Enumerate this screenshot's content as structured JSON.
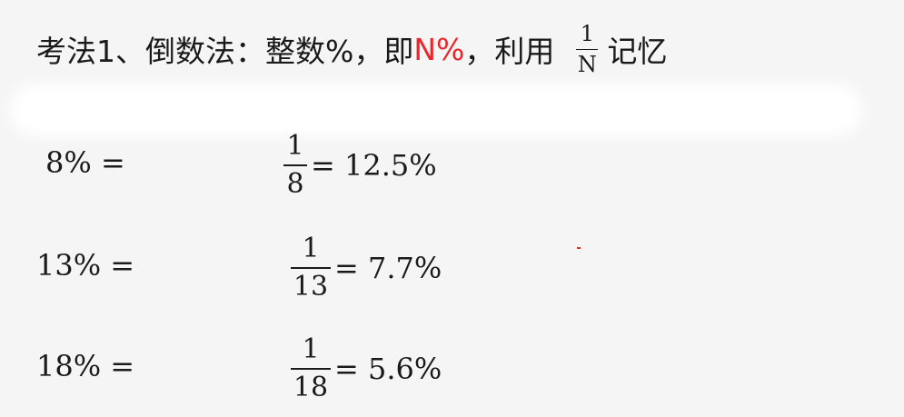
{
  "title": {
    "prefix": "考法1、倒数法：整数%，即",
    "highlight": "N%",
    "middle": "，利用",
    "fraction": {
      "numerator": "1",
      "denominator": "N"
    },
    "suffix": "记忆"
  },
  "rows": [
    {
      "lhs": "8% =",
      "numerator": "1",
      "denominator": "8",
      "result": "= 12.5%"
    },
    {
      "lhs": "13% =",
      "numerator": "1",
      "denominator": "13",
      "result": "= 7.7%"
    },
    {
      "lhs": "18% =",
      "numerator": "1",
      "denominator": "18",
      "result": "= 5.6%"
    }
  ],
  "colors": {
    "text": "#1a1a1a",
    "accent": "#e8262b",
    "background": "#f5f5f5"
  }
}
